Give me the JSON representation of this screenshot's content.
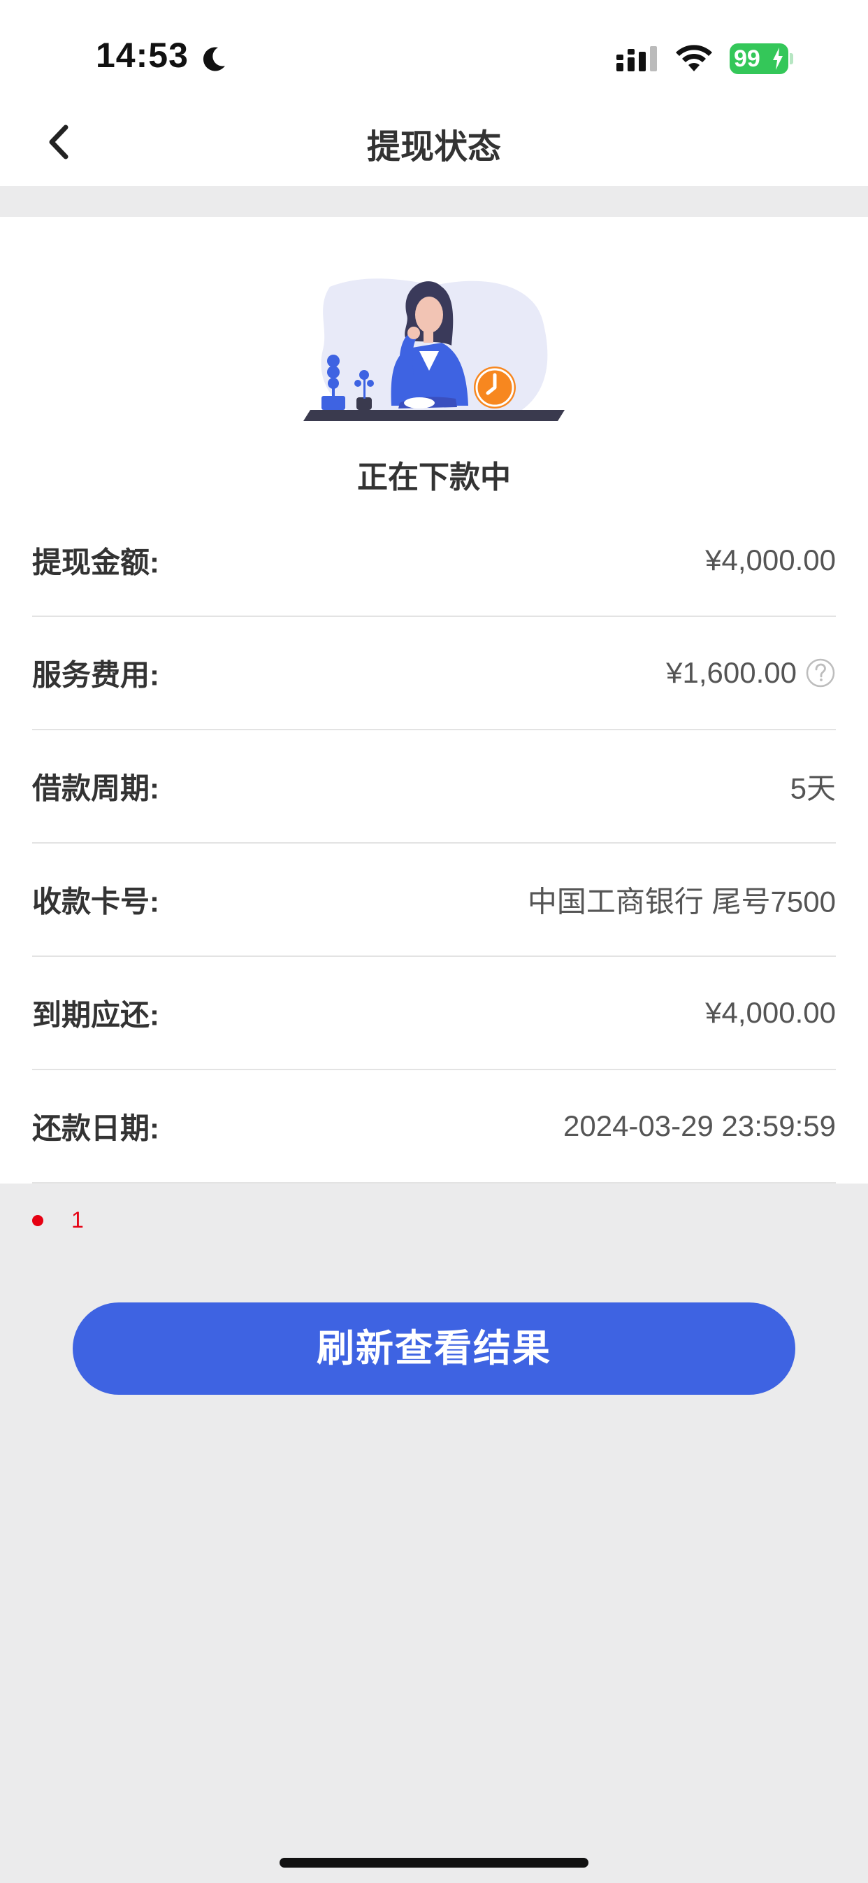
{
  "status_bar": {
    "time": "14:53",
    "battery": "99",
    "icons": [
      "moon-icon",
      "signal-icon",
      "wifi-icon",
      "battery-icon",
      "charging-bolt-icon"
    ]
  },
  "nav": {
    "title": "提现状态",
    "back_icon": "chevron-left-icon"
  },
  "card": {
    "status_text": "正在下款中",
    "illustration": "woman-waiting-clock-illustration",
    "rows": [
      {
        "label": "提现金额:",
        "value": "¥4,000.00"
      },
      {
        "label": "服务费用:",
        "value": "¥1,600.00",
        "icon": "question-circle-icon"
      },
      {
        "label": "借款周期:",
        "value": "5天"
      },
      {
        "label": "收款卡号:",
        "value": "中国工商银行 尾号7500"
      },
      {
        "label": "到期应还:",
        "value": "¥4,000.00"
      },
      {
        "label": "还款日期:",
        "value": "2024-03-29 23:59:59"
      }
    ]
  },
  "indicator": {
    "text": "1",
    "color": "#e60012"
  },
  "refresh_button": {
    "label": "刷新查看结果"
  },
  "colors": {
    "accent": "#3e63e2",
    "background": "#ebebec",
    "battery": "#34c759",
    "clock": "#f7871f"
  }
}
